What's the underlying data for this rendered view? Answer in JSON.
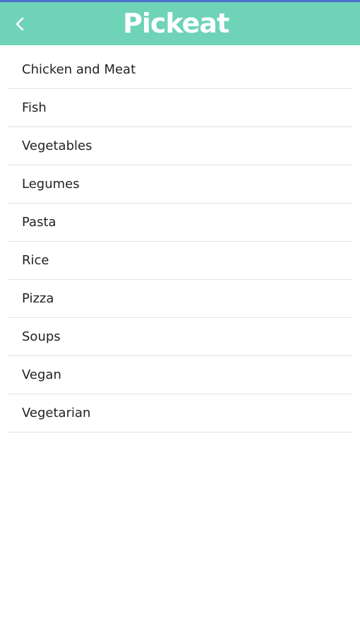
{
  "app_bar": {
    "background_color": "#6ed3b7",
    "status_strip_color": "#4f6ec9",
    "back_icon": "chevron-left-icon",
    "logo_text": "Pickeat"
  },
  "categories": [
    {
      "label": "Chicken and Meat"
    },
    {
      "label": "Fish"
    },
    {
      "label": "Vegetables"
    },
    {
      "label": "Legumes"
    },
    {
      "label": "Pasta"
    },
    {
      "label": "Rice"
    },
    {
      "label": "Pizza"
    },
    {
      "label": "Soups"
    },
    {
      "label": "Vegan"
    },
    {
      "label": "Vegetarian"
    }
  ]
}
